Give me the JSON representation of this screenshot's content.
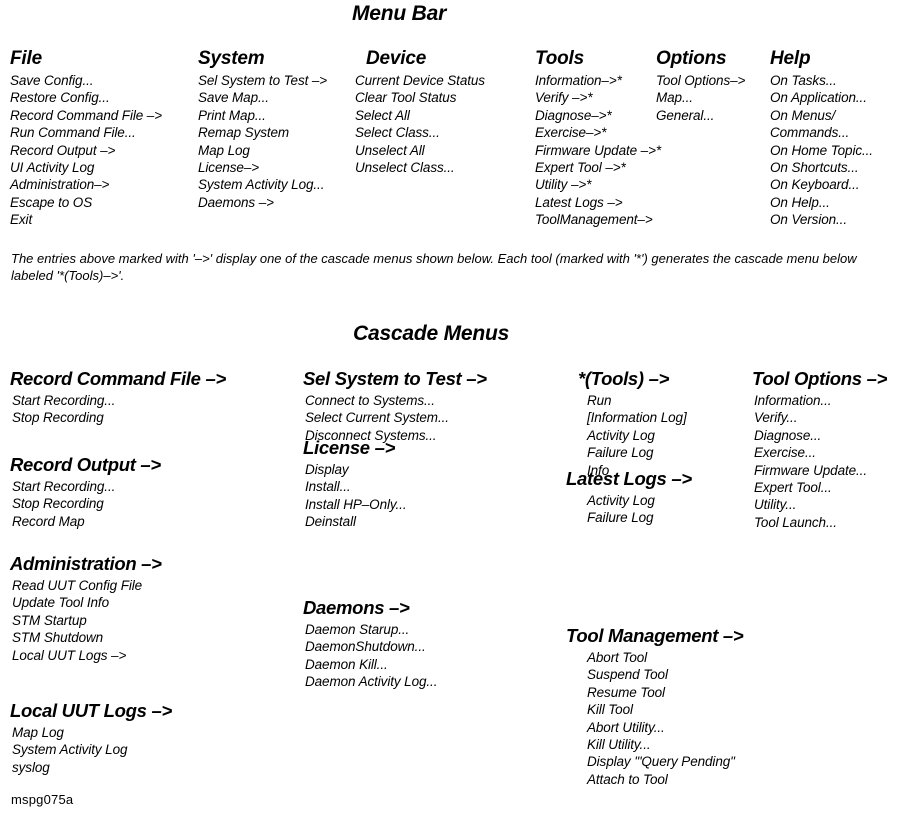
{
  "document": {
    "id_code": "mspg075a"
  },
  "menu_bar": {
    "title": "Menu Bar",
    "columns": [
      {
        "name": "file",
        "header": "File",
        "items": [
          "Save Config...",
          "Restore Config...",
          "Record Command File –>",
          "Run Command File...",
          "Record Output –>",
          "UI Activity Log",
          "Administration–>",
          "Escape to OS",
          "Exit"
        ]
      },
      {
        "name": "system",
        "header": "System",
        "items": [
          "Sel System to Test –>",
          "Save Map...",
          "Print Map...",
          "Remap System",
          "Map Log",
          "License–>",
          "System Activity Log...",
          "Daemons –>"
        ]
      },
      {
        "name": "device",
        "header": "Device",
        "items": [
          "Current Device Status",
          "Clear Tool Status",
          "Select All",
          "Select Class...",
          "Unselect All",
          "Unselect Class..."
        ]
      },
      {
        "name": "tools",
        "header": "Tools",
        "items": [
          "Information–>*",
          "Verify –>*",
          "Diagnose–>*",
          "Exercise–>*",
          "Firmware Update –>*",
          "Expert Tool –>*",
          "Utility –>*",
          "Latest Logs –>",
          "ToolManagement–>"
        ]
      },
      {
        "name": "options",
        "header": "Options",
        "items": [
          "Tool Options–>",
          "Map...",
          "General..."
        ]
      },
      {
        "name": "help",
        "header": "Help",
        "items": [
          "On Tasks...",
          "On Application...",
          "On Menus/",
          "Commands...",
          "On Home Topic...",
          "On Shortcuts...",
          "On Keyboard...",
          "On Help...",
          "On Version..."
        ]
      }
    ],
    "note": "The entries above marked with '–>' display one of the cascade menus shown below.  Each tool (marked with '*') generates the cascade menu below labeled '*(Tools)–>'."
  },
  "cascade_menus": {
    "title": "Cascade Menus",
    "groups": [
      {
        "name": "record-command-file",
        "header": "Record Command File –>",
        "items": [
          "Start Recording...",
          "Stop Recording"
        ]
      },
      {
        "name": "record-output",
        "header": "Record Output –>",
        "items": [
          "Start Recording...",
          "Stop Recording",
          "Record Map"
        ]
      },
      {
        "name": "administration",
        "header": "Administration –>",
        "items": [
          "Read UUT Config File",
          "Update Tool Info",
          "STM Startup",
          "STM Shutdown",
          "Local UUT Logs –>"
        ]
      },
      {
        "name": "local-uut-logs",
        "header": "Local UUT Logs –>",
        "items": [
          "Map Log",
          "System Activity Log",
          "syslog"
        ]
      },
      {
        "name": "sel-system-to-test",
        "header": "Sel System to Test –>",
        "items": [
          "Connect to Systems...",
          "Select Current System...",
          "Disconnect Systems..."
        ]
      },
      {
        "name": "license",
        "header": "License –>",
        "items": [
          "Display",
          "Install...",
          "Install HP–Only...",
          "Deinstall"
        ]
      },
      {
        "name": "daemons",
        "header": "Daemons –>",
        "items": [
          "Daemon Starup...",
          "DaemonShutdown...",
          "Daemon Kill...",
          "Daemon Activity Log..."
        ]
      },
      {
        "name": "tools-star",
        "header": "*(Tools) –>",
        "items": [
          "Run",
          "[Information Log]",
          "Activity Log",
          "Failure Log",
          "Info"
        ]
      },
      {
        "name": "latest-logs",
        "header": "Latest Logs –>",
        "items": [
          "Activity Log",
          "Failure Log"
        ]
      },
      {
        "name": "tool-management",
        "header": "Tool Management –>",
        "items": [
          "Abort Tool",
          "Suspend Tool",
          "Resume Tool",
          "Kill Tool",
          "Abort Utility...",
          "Kill Utility...",
          "Display '\"Query Pending\"",
          "Attach to Tool"
        ]
      },
      {
        "name": "tool-options",
        "header": "Tool Options –>",
        "items": [
          "Information...",
          "Verify...",
          "Diagnose...",
          "Exercise...",
          "Firmware Update...",
          "Expert Tool...",
          "Utility...",
          "Tool Launch..."
        ]
      }
    ]
  }
}
